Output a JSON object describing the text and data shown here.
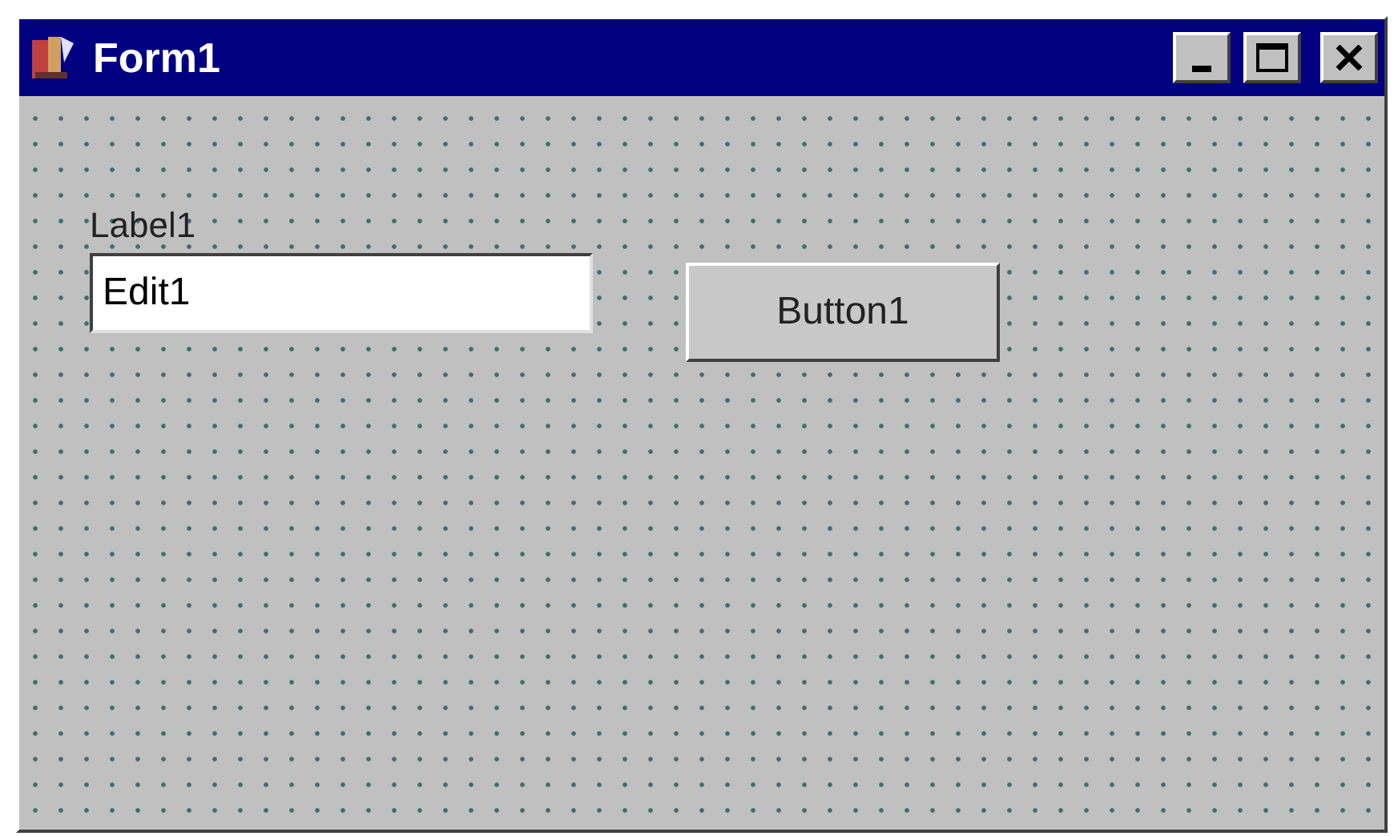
{
  "window": {
    "title": "Form1"
  },
  "form": {
    "label": "Label1",
    "edit": {
      "value": "Edit1"
    },
    "button": {
      "label": "Button1"
    }
  }
}
